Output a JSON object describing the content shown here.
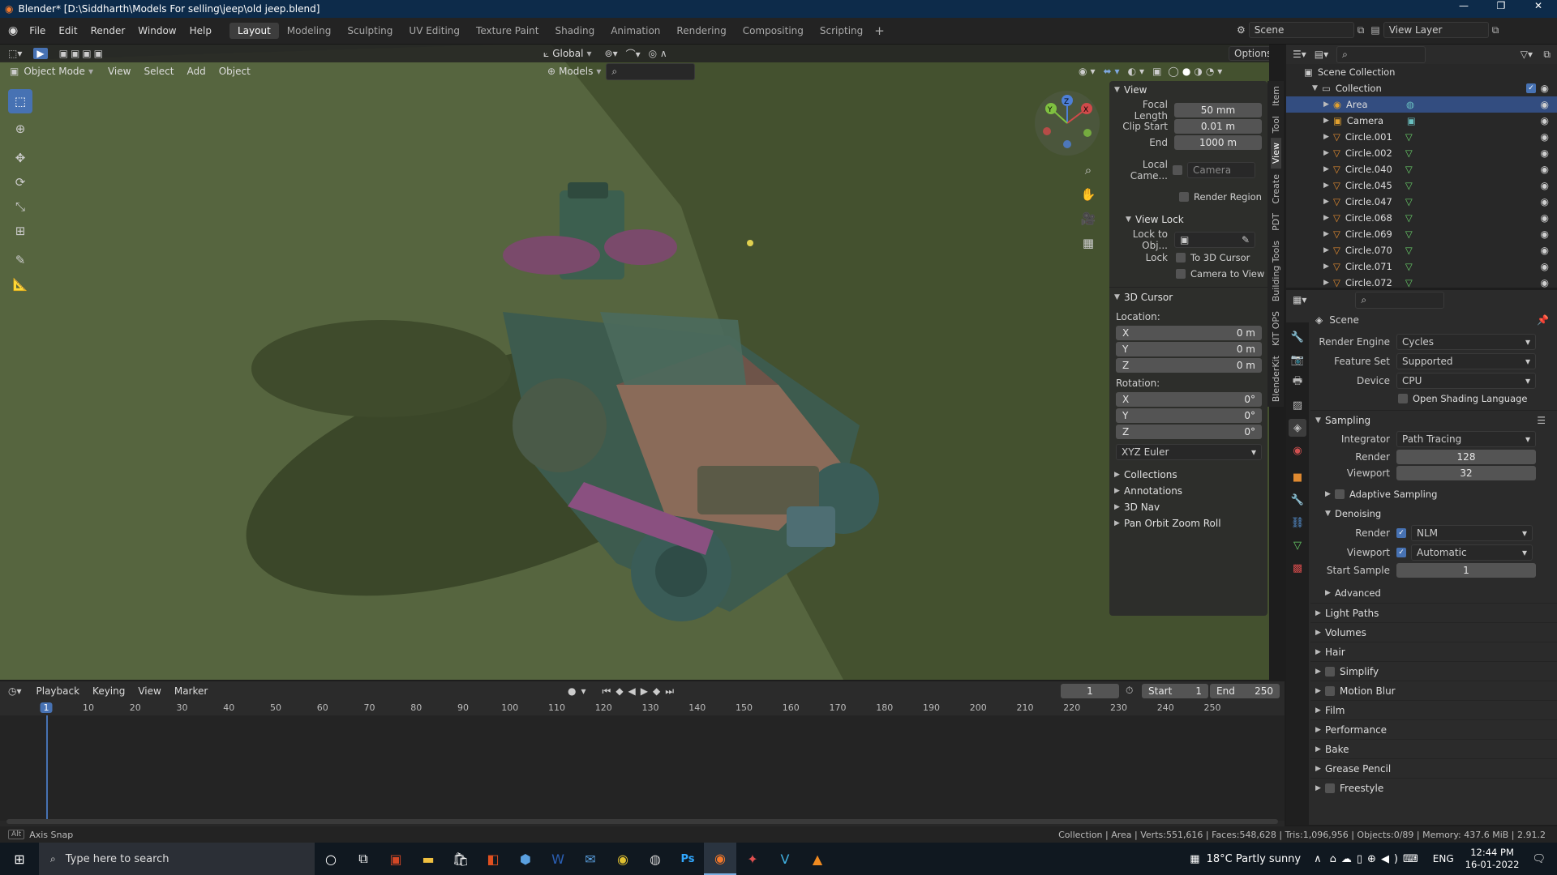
{
  "window": {
    "title": "Blender* [D:\\Siddharth\\Models For selling\\jeep\\old jeep.blend]"
  },
  "menu": {
    "items": [
      "File",
      "Edit",
      "Render",
      "Window",
      "Help"
    ]
  },
  "workspaces": [
    "Layout",
    "Modeling",
    "Sculpting",
    "UV Editing",
    "Texture Paint",
    "Shading",
    "Animation",
    "Rendering",
    "Compositing",
    "Scripting"
  ],
  "scene_selector": {
    "scene": "Scene",
    "view_layer": "View Layer"
  },
  "viewport_header": {
    "transform_orientation": "Global",
    "options": "Options",
    "mode": "Object Mode",
    "menus": [
      "View",
      "Select",
      "Add",
      "Object"
    ],
    "collection_filter": "Models"
  },
  "npanel": {
    "tabs": [
      "Item",
      "Tool",
      "View",
      "Create",
      "PDT",
      "Building Tools",
      "KIT OPS",
      "BlenderKit"
    ],
    "view_header": "View",
    "focal_length_label": "Focal Length",
    "focal_length": "50 mm",
    "clip_start_label": "Clip Start",
    "clip_start": "0.01 m",
    "clip_end_label": "End",
    "clip_end": "1000 m",
    "local_camera_label": "Local Came...",
    "local_camera_value": "Camera",
    "render_region": "Render Region",
    "view_lock_header": "View Lock",
    "lock_to_obj_label": "Lock to Obj...",
    "lock_label": "Lock",
    "to_3d_cursor": "To 3D Cursor",
    "camera_to_view": "Camera to View",
    "cursor_header": "3D Cursor",
    "location_label": "Location:",
    "rotation_label": "Rotation:",
    "loc": [
      {
        "axis": "X",
        "value": "0 m"
      },
      {
        "axis": "Y",
        "value": "0 m"
      },
      {
        "axis": "Z",
        "value": "0 m"
      }
    ],
    "rot": [
      {
        "axis": "X",
        "value": "0°"
      },
      {
        "axis": "Y",
        "value": "0°"
      },
      {
        "axis": "Z",
        "value": "0°"
      }
    ],
    "rotation_mode": "XYZ Euler",
    "collapsed": [
      "Collections",
      "Annotations",
      "3D Nav",
      "Pan Orbit Zoom Roll"
    ]
  },
  "outliner": {
    "scene_collection": "Scene Collection",
    "collection": "Collection",
    "items": [
      {
        "name": "Area",
        "type": "light",
        "selected": true
      },
      {
        "name": "Camera",
        "type": "camera"
      },
      {
        "name": "Circle.001",
        "type": "mesh"
      },
      {
        "name": "Circle.002",
        "type": "mesh"
      },
      {
        "name": "Circle.040",
        "type": "mesh"
      },
      {
        "name": "Circle.045",
        "type": "mesh"
      },
      {
        "name": "Circle.047",
        "type": "mesh"
      },
      {
        "name": "Circle.068",
        "type": "mesh"
      },
      {
        "name": "Circle.069",
        "type": "mesh"
      },
      {
        "name": "Circle.070",
        "type": "mesh"
      },
      {
        "name": "Circle.071",
        "type": "mesh"
      },
      {
        "name": "Circle.072",
        "type": "mesh"
      }
    ]
  },
  "properties": {
    "context": "Scene",
    "render_engine_label": "Render Engine",
    "render_engine": "Cycles",
    "feature_set_label": "Feature Set",
    "feature_set": "Supported",
    "device_label": "Device",
    "device": "CPU",
    "osl": "Open Shading Language",
    "sampling": "Sampling",
    "integrator_label": "Integrator",
    "integrator": "Path Tracing",
    "render_label": "Render",
    "render_samples": "128",
    "viewport_label": "Viewport",
    "viewport_samples": "32",
    "adaptive_sampling": "Adaptive Sampling",
    "denoising": "Denoising",
    "denoise_render_label": "Render",
    "denoise_render": "NLM",
    "denoise_viewport_label": "Viewport",
    "denoise_viewport": "Automatic",
    "start_sample_label": "Start Sample",
    "start_sample": "1",
    "advanced": "Advanced",
    "panels": [
      "Light Paths",
      "Volumes",
      "Hair",
      "Simplify",
      "Motion Blur",
      "Film",
      "Performance",
      "Bake",
      "Grease Pencil",
      "Freestyle"
    ]
  },
  "timeline": {
    "menus": [
      "Playback",
      "Keying",
      "View",
      "Marker"
    ],
    "current_frame": "1",
    "start_label": "Start",
    "start": "1",
    "end_label": "End",
    "end": "250",
    "ticks": [
      "1",
      "10",
      "20",
      "30",
      "40",
      "50",
      "60",
      "70",
      "80",
      "90",
      "100",
      "110",
      "120",
      "130",
      "140",
      "150",
      "160",
      "170",
      "180",
      "190",
      "200",
      "210",
      "220",
      "230",
      "240",
      "250"
    ]
  },
  "statusbar": {
    "left": "Axis Snap",
    "right": "Collection | Area | Verts:551,616 | Faces:548,628 | Tris:1,096,956 | Objects:0/89 | Memory: 437.6 MiB | 2.91.2"
  },
  "taskbar": {
    "search_placeholder": "Type here to search",
    "weather": "18°C  Partly sunny",
    "lang": "ENG",
    "time": "12:44 PM",
    "date": "16-01-2022"
  }
}
